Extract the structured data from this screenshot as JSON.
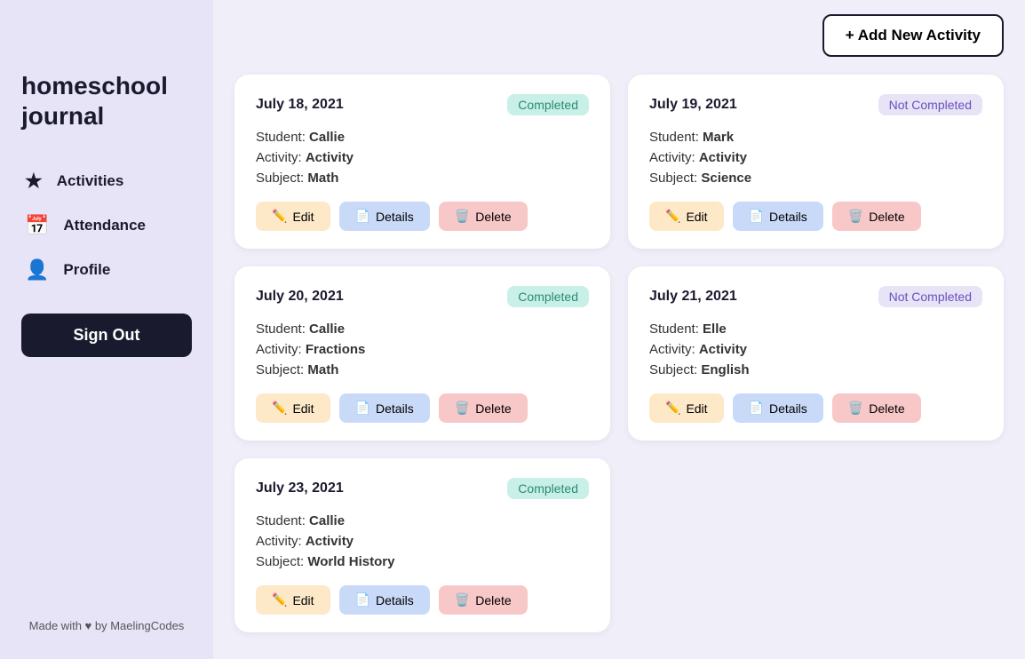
{
  "sidebar": {
    "title_line1": "homeschool",
    "title_line2": "journal",
    "nav": [
      {
        "id": "activities",
        "icon": "★",
        "label": "Activities"
      },
      {
        "id": "attendance",
        "icon": "📅",
        "label": "Attendance"
      },
      {
        "id": "profile",
        "icon": "👤",
        "label": "Profile"
      }
    ],
    "sign_out_label": "Sign Out",
    "footer": "Made with ♥ by MaelingCodes"
  },
  "header": {
    "add_button_label": "+ Add New Activity"
  },
  "cards": [
    {
      "id": "card-1",
      "date": "July 18, 2021",
      "status": "Completed",
      "status_type": "completed",
      "student_label": "Student:",
      "student_value": "Callie",
      "activity_label": "Activity:",
      "activity_value": "Activity",
      "subject_label": "Subject:",
      "subject_value": "Math"
    },
    {
      "id": "card-2",
      "date": "July 19, 2021",
      "status": "Not Completed",
      "status_type": "not-completed",
      "student_label": "Student:",
      "student_value": "Mark",
      "activity_label": "Activity:",
      "activity_value": "Activity",
      "subject_label": "Subject:",
      "subject_value": "Science"
    },
    {
      "id": "card-3",
      "date": "July 20, 2021",
      "status": "Completed",
      "status_type": "completed",
      "student_label": "Student:",
      "student_value": "Callie",
      "activity_label": "Activity:",
      "activity_value": "Fractions",
      "subject_label": "Subject:",
      "subject_value": "Math"
    },
    {
      "id": "card-4",
      "date": "July 21, 2021",
      "status": "Not Completed",
      "status_type": "not-completed",
      "student_label": "Student:",
      "student_value": "Elle",
      "activity_label": "Activity:",
      "activity_value": "Activity",
      "subject_label": "Subject:",
      "subject_value": "English"
    },
    {
      "id": "card-5",
      "date": "July 23, 2021",
      "status": "Completed",
      "status_type": "completed",
      "student_label": "Student:",
      "student_value": "Callie",
      "activity_label": "Activity:",
      "activity_value": "Activity",
      "subject_label": "Subject:",
      "subject_value": "World History"
    }
  ],
  "buttons": {
    "edit": "Edit",
    "details": "Details",
    "delete": "Delete"
  }
}
